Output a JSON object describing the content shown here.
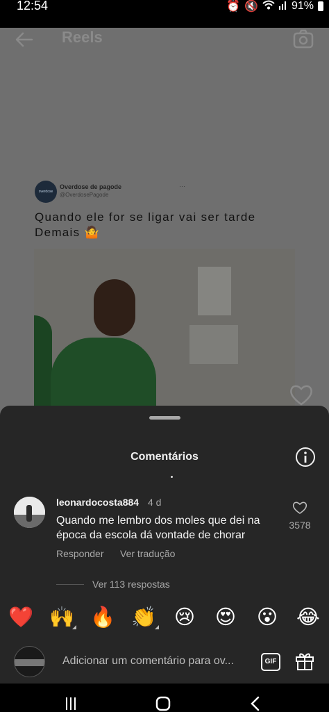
{
  "status_bar": {
    "time": "12:54",
    "icons": [
      "alarm-icon",
      "mute-icon",
      "wifi-icon",
      "signal-icon"
    ],
    "battery": "91%"
  },
  "reel": {
    "title": "Reels",
    "tweet": {
      "avatar_text": "overdose",
      "name": "Overdose de pagode",
      "handle": "@OverdosePagode",
      "dots": "···",
      "text": "Quando ele for se ligar vai ser tarde Demais 🤷"
    }
  },
  "comments": {
    "title": "Comentários",
    "items": [
      {
        "username": "leonardocosta884",
        "time": "4 d",
        "text": "Quando me lembro dos moles que dei na época da escola dá vontade de chorar",
        "reply_label": "Responder",
        "translate_label": "Ver tradução",
        "likes": "3578",
        "replies_label": "Ver 113 respostas"
      }
    ],
    "emojis": [
      "❤️",
      "🙌",
      "🔥",
      "👏",
      "😢",
      "😍",
      "😮",
      "😂"
    ],
    "composer": {
      "placeholder": "Adicionar um comentário para ov...",
      "gif_label": "GIF"
    }
  },
  "colors": {
    "sheet_bg": "#262626",
    "dim_overlay": "#6f6f6f",
    "secondary_text": "#a8a8a8"
  }
}
